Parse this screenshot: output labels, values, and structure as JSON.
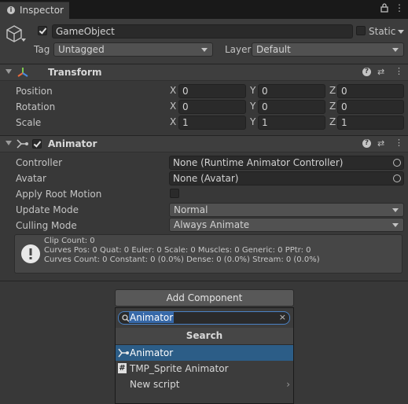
{
  "window": {
    "tab_title": "Inspector"
  },
  "header": {
    "object_name": "GameObject",
    "static_label": "Static",
    "tag_label": "Tag",
    "tag_value": "Untagged",
    "layer_label": "Layer",
    "layer_value": "Default"
  },
  "transform": {
    "title": "Transform",
    "rows": [
      {
        "label": "Position",
        "x": "0",
        "y": "0",
        "z": "0"
      },
      {
        "label": "Rotation",
        "x": "0",
        "y": "0",
        "z": "0"
      },
      {
        "label": "Scale",
        "x": "1",
        "y": "1",
        "z": "1"
      }
    ],
    "axis": {
      "x": "X",
      "y": "Y",
      "z": "Z"
    }
  },
  "animator": {
    "title": "Animator",
    "controller_label": "Controller",
    "controller_value": "None (Runtime Animator Controller)",
    "avatar_label": "Avatar",
    "avatar_value": "None (Avatar)",
    "apply_root_motion_label": "Apply Root Motion",
    "update_mode_label": "Update Mode",
    "update_mode_value": "Normal",
    "culling_mode_label": "Culling Mode",
    "culling_mode_value": "Always Animate",
    "info": {
      "line1": "Clip Count: 0",
      "line2": "Curves Pos: 0 Quat: 0 Euler: 0 Scale: 0 Muscles: 0 Generic: 0 PPtr: 0",
      "line3": "Curves Count: 0 Constant: 0 (0.0%) Dense: 0 (0.0%) Stream: 0 (0.0%)"
    }
  },
  "add_component": {
    "button_label": "Add Component",
    "search_value": "Animator",
    "search_header": "Search",
    "results": [
      {
        "label": "Animator",
        "icon": "animator-icon",
        "selected": true
      },
      {
        "label": "TMP_Sprite Animator",
        "icon": "script-hash-icon",
        "selected": false
      },
      {
        "label": "New script",
        "icon": "chevron-right-icon",
        "selected": false
      }
    ]
  },
  "colors": {
    "selection": "#2c5d87",
    "accent": "#4a82c4",
    "background": "#383838"
  }
}
